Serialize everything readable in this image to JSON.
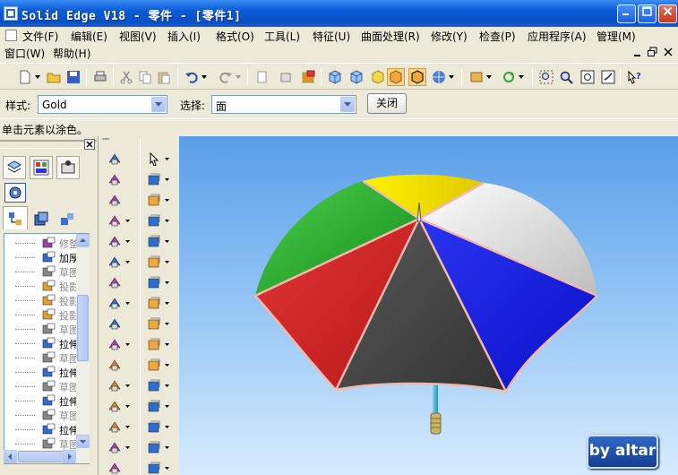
{
  "window": {
    "title": "Solid Edge V18 - 零件 - [零件1]"
  },
  "menu": {
    "items": [
      "文件(F)",
      "编辑(E)",
      "视图(V)",
      "插入(I)",
      "格式(O)",
      "工具(L)",
      "特征(U)",
      "曲面处理(R)",
      "修改(Y)",
      "检查(P)",
      "应用程序(A)",
      "管理(M)"
    ],
    "row2": [
      "窗口(W)",
      "帮助(H)"
    ]
  },
  "ribbon": {
    "style_label": "样式:",
    "style_value": "Gold",
    "select_label": "选择:",
    "select_value": "面",
    "close_label": "关闭"
  },
  "status": {
    "prompt": "单击元素以涂色。"
  },
  "tree": {
    "items": [
      {
        "label": "修整",
        "dim": true
      },
      {
        "label": "加厚",
        "dim": false
      },
      {
        "label": "草图",
        "dim": true
      },
      {
        "label": "投影",
        "dim": true
      },
      {
        "label": "投影",
        "dim": true
      },
      {
        "label": "投影",
        "dim": true
      },
      {
        "label": "草图",
        "dim": true
      },
      {
        "label": "拉伸",
        "dim": false
      },
      {
        "label": "草图",
        "dim": true
      },
      {
        "label": "拉伸",
        "dim": false
      },
      {
        "label": "草图",
        "dim": true
      },
      {
        "label": "拉伸",
        "dim": false
      },
      {
        "label": "草图",
        "dim": true
      },
      {
        "label": "拉伸",
        "dim": false
      },
      {
        "label": "草图",
        "dim": true
      }
    ]
  },
  "watermark": {
    "text": "by altar"
  },
  "colors": {
    "titlebar": "#0b4fc4",
    "panel": "#ece9d8",
    "umbrella_red": "#dc2626",
    "umbrella_green": "#22a528",
    "umbrella_yellow": "#ffee00",
    "umbrella_white": "#f2f2f2",
    "umbrella_blue": "#1a25e6",
    "umbrella_gray": "#4a4a4a",
    "handle": "#3ab6d6"
  }
}
